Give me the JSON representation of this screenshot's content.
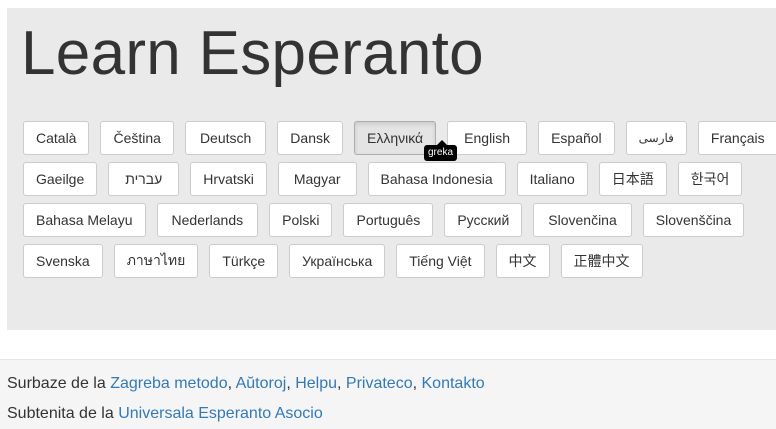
{
  "header": {
    "title": "Learn Esperanto"
  },
  "languages": {
    "rows": [
      [
        "Català",
        "Čeština",
        "Deutsch",
        "Dansk",
        "Ελληνικά",
        "English",
        "Español",
        "فارسی",
        "Français"
      ],
      [
        "Gaeilge",
        "עברית",
        "Hrvatski",
        "Magyar",
        "Bahasa Indonesia",
        "Italiano",
        "日本語",
        "한국어"
      ],
      [
        "Bahasa Melayu",
        "Nederlands",
        "Polski",
        "Português",
        "Русский",
        "Slovenčina",
        "Slovenščina"
      ],
      [
        "Svenska",
        "ภาษาไทย",
        "Türkçe",
        "Українська",
        "Tiếng Việt",
        "中文",
        "正體中文"
      ]
    ],
    "active": "Ελληνικά"
  },
  "tooltip": {
    "text": "greka"
  },
  "footer": {
    "line1_prefix": "Surbaze de la ",
    "line1_links": [
      "Zagreba metodo",
      "Aŭtoroj",
      "Helpu",
      "Privateco",
      "Kontakto"
    ],
    "line1_separator": ", ",
    "line2_prefix": "Subtenita de la ",
    "line2_link": "Universala Esperanto Asocio"
  },
  "colors": {
    "link": "#337ab7",
    "hero_bg": "#eaeaea",
    "footer_bg": "#f5f5f5"
  }
}
